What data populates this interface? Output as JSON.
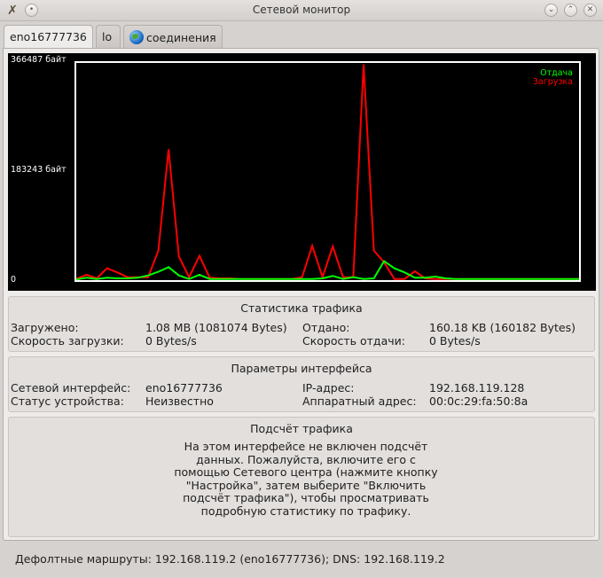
{
  "window": {
    "title": "Сетевой монитор",
    "icons": {
      "app": "kde-tools-icon",
      "menu": "circle-menu-icon",
      "minimize": "chevron-down-icon",
      "maximize": "chevron-up-icon",
      "close": "close-icon"
    }
  },
  "tabs": [
    {
      "label": "eno16777736",
      "active": true
    },
    {
      "label": "lo",
      "active": false
    },
    {
      "label": "соединения",
      "active": false,
      "icon": "globe-icon"
    }
  ],
  "chart_data": {
    "type": "line",
    "ylim": [
      0,
      366487
    ],
    "y_tick_labels": [
      "366487 байт",
      "183243 байт",
      "0"
    ],
    "legend_position": "top-right",
    "background": "#000000",
    "frame_color": "#ffffff",
    "x": [
      0,
      1,
      2,
      3,
      4,
      5,
      6,
      7,
      8,
      9,
      10,
      11,
      12,
      13,
      14,
      15,
      16,
      17,
      18,
      19,
      20,
      21,
      22,
      23,
      24,
      25,
      26,
      27,
      28,
      29,
      30,
      31,
      32,
      33,
      34,
      35,
      36,
      37,
      38,
      39,
      40,
      41,
      42,
      43,
      44,
      45,
      46,
      47,
      48,
      49
    ],
    "series": [
      {
        "name": "Отдача",
        "color": "#00ff00",
        "values": [
          1000,
          4000,
          2000,
          4000,
          3000,
          3000,
          4000,
          8000,
          14000,
          22000,
          8000,
          2000,
          9000,
          2000,
          2000,
          2000,
          2000,
          2000,
          2000,
          2000,
          2000,
          2000,
          2000,
          2000,
          3000,
          7000,
          2000,
          5000,
          2000,
          3000,
          32000,
          20000,
          13000,
          4000,
          4000,
          6000,
          3000,
          2000,
          2000,
          2000,
          2000,
          2000,
          2000,
          2000,
          2000,
          2000,
          2000,
          2000,
          2000,
          2000
        ]
      },
      {
        "name": "Загрузка",
        "color": "#ff0000",
        "values": [
          2000,
          9000,
          3000,
          20000,
          13000,
          5000,
          5000,
          5000,
          50000,
          221000,
          40000,
          5000,
          41000,
          4000,
          3000,
          3000,
          2000,
          2000,
          2000,
          2000,
          2000,
          2000,
          5000,
          58000,
          5000,
          57000,
          5000,
          5000,
          364000,
          50000,
          30000,
          2000,
          2000,
          15000,
          3000,
          2000,
          2000,
          2000,
          2000,
          2000,
          2000,
          2000,
          2000,
          2000,
          2000,
          2000,
          2000,
          2000,
          2000,
          2000
        ]
      }
    ]
  },
  "traffic_stats": {
    "title": "Статистика трафика",
    "received_label": "Загружено:",
    "received_value": "1.08 MB (1081074 Bytes)",
    "sent_label": "Отдано:",
    "sent_value": "160.18 KB (160182 Bytes)",
    "down_speed_label": "Скорость загрузки:",
    "down_speed_value": "0 Bytes/s",
    "up_speed_label": "Скорость отдачи:",
    "up_speed_value": "0 Bytes/s"
  },
  "interface_params": {
    "title": "Параметры интерфейса",
    "iface_label": "Сетевой интерфейс:",
    "iface_value": "eno16777736",
    "ip_label": "IP-адрес:",
    "ip_value": "192.168.119.128",
    "status_label": "Статус устройства:",
    "status_value": "Неизвестно",
    "mac_label": "Аппаратный адрес:",
    "mac_value": "00:0c:29:fa:50:8a"
  },
  "traffic_count": {
    "title": "Подсчёт трафика",
    "message": "На этом интерфейсе не включен подсчёт данных. Пожалуйста, включите его с помощью Сетевого центра (нажмите кнопку \"Настройка\", затем выберите \"Включить подсчёт трафика\"), чтобы просматривать подробную статистику по трафику."
  },
  "footer": {
    "text": "Дефолтные маршруты: 192.168.119.2 (eno16777736); DNS: 192.168.119.2"
  }
}
